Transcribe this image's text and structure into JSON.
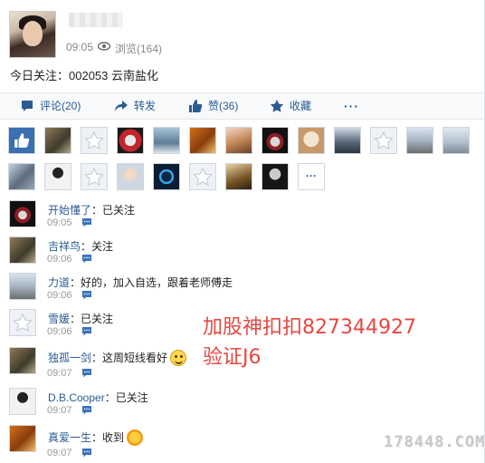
{
  "post": {
    "time": "09:05",
    "views_label": "浏览(164)",
    "content": "今日关注：002053 云南盐化"
  },
  "actions": {
    "comment": "评论(20)",
    "forward": "转发",
    "like": "赞(36)",
    "collect": "收藏",
    "more": "···"
  },
  "likes_more": "···",
  "comments": [
    {
      "name": "开始懂了",
      "text": "：已关注",
      "time": "09:05"
    },
    {
      "name": "吉祥鸟",
      "text": "：关注",
      "time": "09:06"
    },
    {
      "name": "力道",
      "text": "：好的，加入自选，跟着老师傅走",
      "time": "09:06"
    },
    {
      "name": "雪媛",
      "text": "：已关注",
      "time": "09:06"
    },
    {
      "name": "独孤一剑",
      "text": "：这周短线看好",
      "time": "09:07"
    },
    {
      "name": "D.B.Cooper",
      "text": "：已关注",
      "time": "09:07"
    },
    {
      "name": "真爱一生",
      "text": "：收到",
      "time": "09:07"
    }
  ],
  "overlay": {
    "line1": "加股神扣扣827344927",
    "line2": "验证J6"
  },
  "watermark": "178448.COM",
  "colors": {
    "link": "#2a5b93",
    "overlay": "#e74842"
  }
}
